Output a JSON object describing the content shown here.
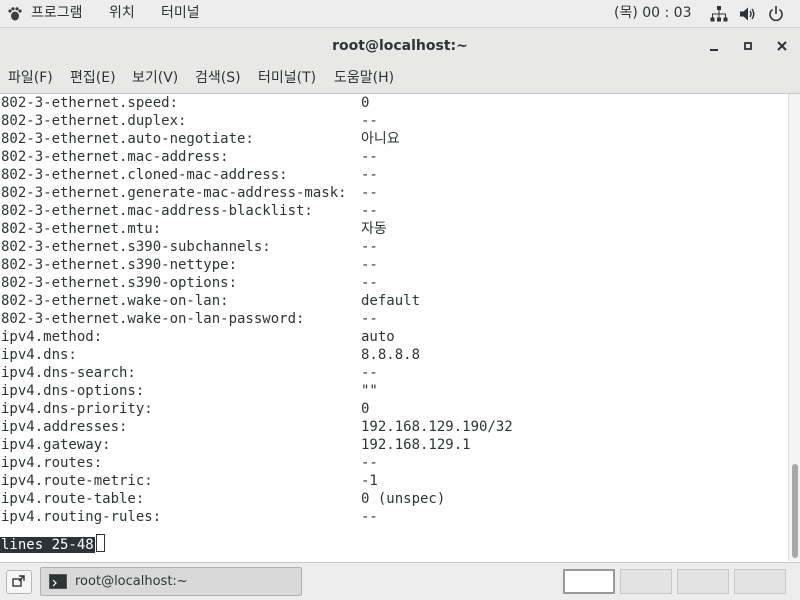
{
  "top_panel": {
    "applications": "프로그램",
    "places": "위치",
    "terminal": "터미널",
    "clock": "(목) 00 : 03"
  },
  "window": {
    "title": "root@localhost:~"
  },
  "menubar": {
    "items": [
      "파일(F)",
      "편집(E)",
      "보기(V)",
      "검색(S)",
      "터미널(T)",
      "도움말(H)"
    ]
  },
  "terminal": {
    "lines": [
      {
        "key": "802-3-ethernet.speed:",
        "value": "0"
      },
      {
        "key": "802-3-ethernet.duplex:",
        "value": "--"
      },
      {
        "key": "802-3-ethernet.auto-negotiate:",
        "value": "아니요"
      },
      {
        "key": "802-3-ethernet.mac-address:",
        "value": "--"
      },
      {
        "key": "802-3-ethernet.cloned-mac-address:",
        "value": "--"
      },
      {
        "key": "802-3-ethernet.generate-mac-address-mask:",
        "value": "--"
      },
      {
        "key": "802-3-ethernet.mac-address-blacklist:",
        "value": "--"
      },
      {
        "key": "802-3-ethernet.mtu:",
        "value": "자동"
      },
      {
        "key": "802-3-ethernet.s390-subchannels:",
        "value": "--"
      },
      {
        "key": "802-3-ethernet.s390-nettype:",
        "value": "--"
      },
      {
        "key": "802-3-ethernet.s390-options:",
        "value": "--"
      },
      {
        "key": "802-3-ethernet.wake-on-lan:",
        "value": "default"
      },
      {
        "key": "802-3-ethernet.wake-on-lan-password:",
        "value": "--"
      },
      {
        "key": "ipv4.method:",
        "value": "auto"
      },
      {
        "key": "ipv4.dns:",
        "value": "8.8.8.8"
      },
      {
        "key": "ipv4.dns-search:",
        "value": "--"
      },
      {
        "key": "ipv4.dns-options:",
        "value": "\"\""
      },
      {
        "key": "ipv4.dns-priority:",
        "value": "0"
      },
      {
        "key": "ipv4.addresses:",
        "value": "192.168.129.190/32"
      },
      {
        "key": "ipv4.gateway:",
        "value": "192.168.129.1"
      },
      {
        "key": "ipv4.routes:",
        "value": "--"
      },
      {
        "key": "ipv4.route-metric:",
        "value": "-1"
      },
      {
        "key": "ipv4.route-table:",
        "value": "0 (unspec)"
      },
      {
        "key": "ipv4.routing-rules:",
        "value": "--"
      }
    ],
    "status": "lines 25-48"
  },
  "taskbar": {
    "task_label": "root@localhost:~"
  },
  "icons": {
    "app_menu": "foot-icon",
    "network": "network-icon",
    "volume": "volume-icon",
    "power": "power-icon",
    "minimize": "minimize-icon",
    "maximize": "maximize-icon",
    "close": "close-icon",
    "show_desktop": "show-desktop-icon",
    "task": "terminal-icon"
  }
}
